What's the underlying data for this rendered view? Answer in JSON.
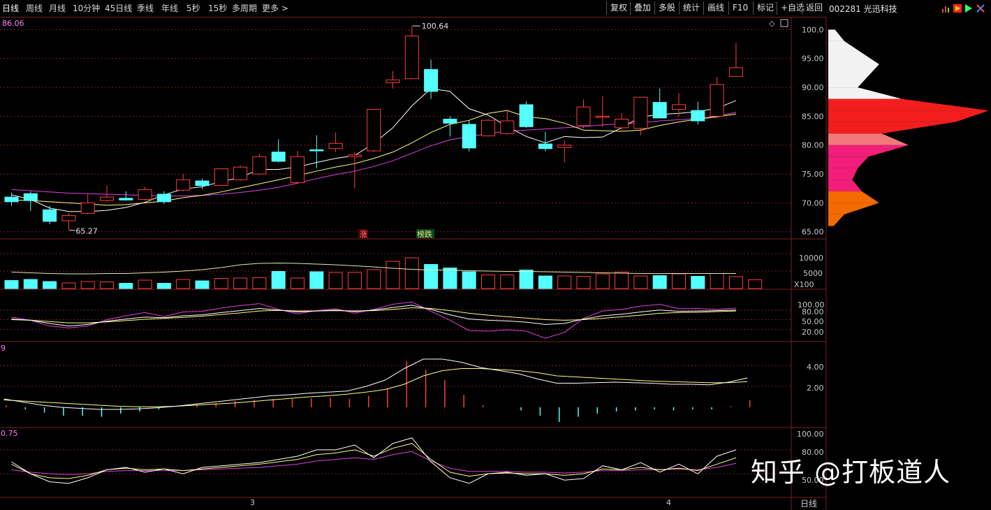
{
  "toolbar": {
    "periods": [
      "日线",
      "周线",
      "月线",
      "10分钟",
      "45日线",
      "季线",
      "年线",
      "5秒",
      "15秒",
      "多周期",
      "更多"
    ],
    "right_buttons": [
      "复权",
      "叠加",
      "多股",
      "统计",
      "画线",
      "F10",
      "标记",
      "+自选",
      "返回"
    ]
  },
  "stock": {
    "title": "002281 光迅科技"
  },
  "price_panel": {
    "corner_value": "86.06",
    "max_label": "100.64",
    "min_label": "65.27",
    "ticks": [
      "100.0",
      "95.00",
      "90.00",
      "85.00",
      "80.00",
      "75.00",
      "70.00",
      "65.00"
    ],
    "markers": [
      {
        "text": "涨"
      },
      {
        "text": "榜跌"
      }
    ]
  },
  "volume_panel": {
    "ticks": [
      "10000",
      "5000"
    ],
    "unit": "X100"
  },
  "kdj_panel": {
    "ticks": [
      "100.00",
      "80.00",
      "50.00",
      "20.00"
    ]
  },
  "macd_panel": {
    "corner_value": "9",
    "ticks": [
      "4.00",
      "2.00"
    ]
  },
  "wr_panel": {
    "corner_value": "0.75",
    "ticks": [
      "100.00",
      "80.00",
      "50.00"
    ]
  },
  "x_axis": {
    "month_labels": [
      "3",
      "4"
    ]
  },
  "period_label": "日线",
  "watermark": "知乎 @打板道人",
  "colors": {
    "up": "#ff3c3c",
    "down": "#54ffff",
    "ma5": "#ffffff",
    "ma10": "#ffff80",
    "ma20": "#e040e0",
    "grid": "#7a1f1f"
  },
  "chart_data": {
    "type": "candlestick",
    "ylim": [
      64.0,
      101.5
    ],
    "candles": [
      {
        "o": 71.0,
        "h": 71.8,
        "l": 69.5,
        "c": 70.2
      },
      {
        "o": 71.6,
        "h": 72.0,
        "l": 68.6,
        "c": 70.4
      },
      {
        "o": 68.8,
        "h": 69.5,
        "l": 66.3,
        "c": 66.8
      },
      {
        "o": 66.9,
        "h": 68.2,
        "l": 65.27,
        "c": 67.8
      },
      {
        "o": 68.2,
        "h": 71.5,
        "l": 68.0,
        "c": 70.0
      },
      {
        "o": 70.4,
        "h": 73.0,
        "l": 70.2,
        "c": 71.0
      },
      {
        "o": 70.8,
        "h": 72.0,
        "l": 70.4,
        "c": 70.5
      },
      {
        "o": 70.6,
        "h": 72.8,
        "l": 70.4,
        "c": 72.3
      },
      {
        "o": 71.5,
        "h": 72.0,
        "l": 69.8,
        "c": 70.2
      },
      {
        "o": 72.2,
        "h": 75.0,
        "l": 72.0,
        "c": 74.0
      },
      {
        "o": 73.8,
        "h": 74.2,
        "l": 72.4,
        "c": 73.0
      },
      {
        "o": 73.0,
        "h": 76.0,
        "l": 73.0,
        "c": 75.9
      },
      {
        "o": 74.0,
        "h": 76.5,
        "l": 73.8,
        "c": 76.2
      },
      {
        "o": 75.0,
        "h": 78.5,
        "l": 74.8,
        "c": 78.0
      },
      {
        "o": 78.8,
        "h": 81.0,
        "l": 77.0,
        "c": 77.2
      },
      {
        "o": 73.5,
        "h": 79.0,
        "l": 73.4,
        "c": 78.0
      },
      {
        "o": 79.2,
        "h": 81.7,
        "l": 76.0,
        "c": 79.0
      },
      {
        "o": 79.4,
        "h": 82.2,
        "l": 78.8,
        "c": 80.3
      },
      {
        "o": 78.0,
        "h": 78.8,
        "l": 72.5,
        "c": 78.3
      },
      {
        "o": 79.0,
        "h": 86.2,
        "l": 78.8,
        "c": 86.2
      },
      {
        "o": 90.8,
        "h": 92.8,
        "l": 89.8,
        "c": 91.3
      },
      {
        "o": 91.5,
        "h": 100.64,
        "l": 91.4,
        "c": 98.9
      },
      {
        "o": 93.1,
        "h": 94.8,
        "l": 88.0,
        "c": 89.3
      },
      {
        "o": 84.5,
        "h": 85.0,
        "l": 81.5,
        "c": 83.8
      },
      {
        "o": 83.6,
        "h": 84.3,
        "l": 78.9,
        "c": 79.5
      },
      {
        "o": 81.6,
        "h": 84.5,
        "l": 81.5,
        "c": 84.3
      },
      {
        "o": 82.0,
        "h": 86.2,
        "l": 81.8,
        "c": 84.2
      },
      {
        "o": 87.0,
        "h": 87.6,
        "l": 83.0,
        "c": 83.2
      },
      {
        "o": 80.2,
        "h": 82.3,
        "l": 78.9,
        "c": 79.4
      },
      {
        "o": 79.6,
        "h": 80.8,
        "l": 77.0,
        "c": 80.0
      },
      {
        "o": 83.4,
        "h": 87.9,
        "l": 82.9,
        "c": 86.6
      },
      {
        "o": 84.8,
        "h": 88.5,
        "l": 83.2,
        "c": 85.0
      },
      {
        "o": 83.0,
        "h": 85.5,
        "l": 82.6,
        "c": 84.5
      },
      {
        "o": 82.9,
        "h": 85.5,
        "l": 81.7,
        "c": 88.3
      },
      {
        "o": 87.4,
        "h": 89.8,
        "l": 84.7,
        "c": 84.7
      },
      {
        "o": 86.2,
        "h": 89.0,
        "l": 84.9,
        "c": 87.0
      },
      {
        "o": 86.0,
        "h": 87.5,
        "l": 83.6,
        "c": 84.2
      },
      {
        "o": 85.0,
        "h": 91.8,
        "l": 84.9,
        "c": 90.5
      },
      {
        "o": 91.9,
        "h": 97.7,
        "l": 91.8,
        "c": 93.4
      }
    ],
    "ma5": [
      71.4,
      70.6,
      69.1,
      68.5,
      68.5,
      68.7,
      69.2,
      70.1,
      71.4,
      72.4,
      72.8,
      73.7,
      74.4,
      75.8,
      75.8,
      76.2,
      77.0,
      77.7,
      78.2,
      80.3,
      83.0,
      86.8,
      89.8,
      89.3,
      86.3,
      85.2,
      83.2,
      81.5,
      80.4,
      81.5,
      81.3,
      81.4,
      83.0,
      84.9,
      85.3,
      85.5,
      85.8,
      86.4,
      87.7
    ],
    "ma10": [
      70.5,
      70.4,
      70.2,
      70.0,
      69.8,
      69.6,
      69.7,
      70.0,
      70.3,
      70.9,
      71.3,
      71.9,
      72.6,
      73.3,
      74.0,
      74.7,
      75.5,
      76.2,
      76.8,
      77.7,
      78.8,
      80.4,
      82.2,
      83.6,
      84.3,
      85.5,
      86.0,
      84.9,
      84.6,
      83.8,
      82.6,
      82.5,
      82.4,
      82.6,
      83.4,
      84.0,
      84.5,
      84.9,
      85.4
    ],
    "ma20": [
      72.3,
      72.1,
      71.9,
      71.7,
      71.6,
      71.5,
      71.4,
      71.3,
      71.2,
      71.2,
      71.3,
      71.5,
      71.8,
      72.2,
      72.7,
      73.4,
      74.2,
      74.9,
      75.5,
      76.3,
      77.3,
      78.6,
      79.9,
      80.9,
      81.5,
      82.0,
      82.4,
      82.6,
      82.8,
      83.0,
      83.2,
      83.5,
      83.7,
      83.9,
      84.2,
      84.4,
      84.6,
      85.0,
      85.7
    ],
    "volume": [
      2300,
      2600,
      2000,
      1600,
      2000,
      1900,
      1500,
      2400,
      1500,
      2600,
      2200,
      2900,
      3000,
      3100,
      4900,
      3000,
      4800,
      4600,
      4600,
      5400,
      7800,
      8800,
      6900,
      5900,
      4800,
      3900,
      3900,
      5300,
      3600,
      3600,
      3500,
      4200,
      4700,
      3600,
      3700,
      4200,
      3500,
      4300,
      3400,
      2500
    ],
    "volume_ma": [
      4700,
      4500,
      4300,
      4200,
      4200,
      4300,
      4300,
      4500,
      4700,
      5000,
      5400,
      6000,
      6800,
      7200,
      7300,
      7200,
      7000,
      6800,
      6500,
      6200,
      5800,
      5500,
      5300,
      5300,
      5100,
      5000,
      4900,
      4900,
      4800,
      4700,
      4600,
      4500,
      4400,
      4300,
      4300,
      4300,
      4300,
      4300,
      4300
    ],
    "kdj": {
      "k": [
        52,
        48,
        38,
        30,
        35,
        45,
        52,
        58,
        56,
        62,
        65,
        72,
        78,
        85,
        80,
        74,
        77,
        80,
        75,
        80,
        88,
        95,
        82,
        65,
        52,
        48,
        46,
        42,
        35,
        38,
        52,
        62,
        67,
        74,
        80,
        76,
        77,
        78,
        80
      ],
      "d": [
        50,
        48,
        44,
        40,
        40,
        43,
        47,
        51,
        54,
        57,
        61,
        66,
        71,
        77,
        79,
        77,
        77,
        78,
        77,
        78,
        82,
        87,
        85,
        78,
        70,
        64,
        59,
        55,
        50,
        48,
        50,
        54,
        59,
        64,
        70,
        72,
        73,
        75,
        77
      ],
      "j": [
        58,
        48,
        30,
        24,
        30,
        50,
        62,
        72,
        60,
        74,
        76,
        86,
        94,
        100,
        82,
        68,
        78,
        84,
        70,
        82,
        98,
        105,
        76,
        48,
        16,
        14,
        18,
        14,
        -8,
        10,
        54,
        77,
        82,
        92,
        98,
        84,
        85,
        82,
        86
      ]
    },
    "macd": {
      "dif": [
        0.8,
        0.5,
        0.2,
        0.0,
        -0.1,
        -0.2,
        -0.2,
        -0.15,
        -0.05,
        0.1,
        0.3,
        0.5,
        0.7,
        0.9,
        1.1,
        1.2,
        1.35,
        1.45,
        1.55,
        2.0,
        2.6,
        3.7,
        4.6,
        4.6,
        4.3,
        3.8,
        3.5,
        3.2,
        2.7,
        2.3,
        2.3,
        2.35,
        2.4,
        2.35,
        2.3,
        2.2,
        2.2,
        2.15,
        2.4,
        2.8
      ],
      "dea": [
        0.7,
        0.6,
        0.5,
        0.4,
        0.3,
        0.2,
        0.1,
        0.05,
        0.05,
        0.1,
        0.2,
        0.3,
        0.4,
        0.55,
        0.7,
        0.85,
        1.0,
        1.1,
        1.25,
        1.45,
        1.7,
        2.2,
        3.0,
        3.5,
        3.7,
        3.7,
        3.6,
        3.5,
        3.3,
        3.0,
        2.9,
        2.8,
        2.7,
        2.6,
        2.5,
        2.45,
        2.4,
        2.35,
        2.35,
        2.45
      ],
      "hist": [
        0.2,
        -0.2,
        -0.5,
        -0.8,
        -0.8,
        -0.9,
        -0.6,
        -0.4,
        -0.2,
        0.0,
        0.2,
        0.4,
        0.6,
        0.7,
        0.8,
        0.8,
        0.85,
        0.9,
        0.8,
        1.1,
        1.8,
        4.4,
        3.6,
        2.6,
        1.2,
        0.2,
        0.0,
        -0.3,
        -0.8,
        -1.4,
        -0.9,
        -0.6,
        -0.4,
        -0.3,
        -0.2,
        -0.3,
        -0.2,
        -0.2,
        0.1,
        0.7
      ]
    },
    "wr": {
      "a": [
        65,
        50,
        40,
        38,
        45,
        55,
        58,
        52,
        56,
        50,
        58,
        60,
        62,
        64,
        68,
        72,
        80,
        80,
        86,
        70,
        88,
        95,
        65,
        45,
        38,
        50,
        52,
        48,
        50,
        42,
        44,
        60,
        55,
        64,
        52,
        62,
        50,
        72,
        80
      ],
      "b": [
        62,
        50,
        45,
        44,
        48,
        55,
        57,
        55,
        56,
        54,
        56,
        58,
        60,
        62,
        65,
        68,
        74,
        76,
        80,
        72,
        82,
        88,
        68,
        52,
        47,
        50,
        51,
        50,
        50,
        48,
        50,
        56,
        55,
        58,
        55,
        57,
        54,
        62,
        70
      ],
      "c": [
        55,
        52,
        50,
        49,
        50,
        53,
        54,
        54,
        54,
        54,
        55,
        56,
        57,
        58,
        60,
        62,
        66,
        68,
        70,
        68,
        74,
        78,
        66,
        57,
        53,
        53,
        53,
        52,
        52,
        51,
        52,
        54,
        54,
        55,
        55,
        56,
        55,
        58,
        63
      ]
    },
    "chip_distribution": {
      "price_levels": [
        100,
        98,
        96,
        94,
        92,
        90,
        88,
        86,
        84,
        82,
        80,
        78,
        76,
        74,
        72,
        70,
        68,
        66
      ],
      "weights": [
        5,
        12,
        25,
        38,
        30,
        22,
        55,
        120,
        95,
        40,
        60,
        30,
        22,
        18,
        25,
        38,
        12,
        4
      ]
    }
  }
}
